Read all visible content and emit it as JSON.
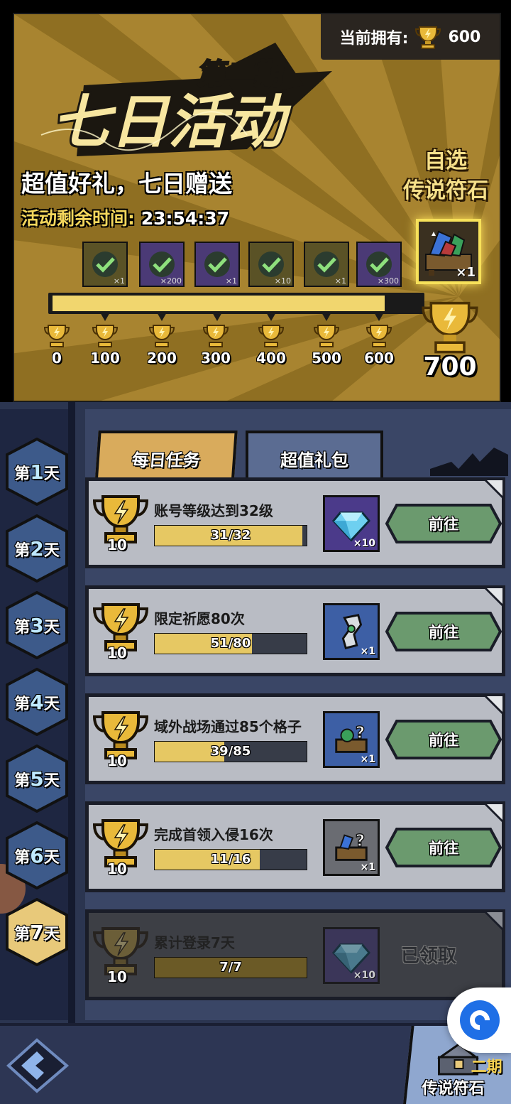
{
  "header": {
    "owned_label": "当前拥有:",
    "owned_value": "600",
    "phase": "第二期",
    "title": "七日活动",
    "subtitle": "超值好礼，七日赠送",
    "timer_label": "活动剩余时间:",
    "timer_value": "23:54:37",
    "pick_line1": "自选",
    "pick_line2": "传说符石"
  },
  "milestones": [
    {
      "points": "0",
      "qty": "×1",
      "claimed": true,
      "kind": "chest"
    },
    {
      "points": "100",
      "qty": "×200",
      "claimed": true,
      "kind": "gem"
    },
    {
      "points": "200",
      "qty": "×1",
      "claimed": true,
      "kind": "scroll"
    },
    {
      "points": "300",
      "qty": "×10",
      "claimed": true,
      "kind": "box"
    },
    {
      "points": "400",
      "qty": "×1",
      "claimed": true,
      "kind": "chest"
    },
    {
      "points": "500",
      "qty": "×300",
      "claimed": true,
      "kind": "gem"
    },
    {
      "points": "600",
      "qty": "",
      "claimed": true,
      "kind": "none"
    }
  ],
  "final_reward": {
    "points": "700",
    "qty": "×1"
  },
  "progress": {
    "current": 600,
    "max": 700
  },
  "days": [
    {
      "label_pre": "第",
      "num": "1",
      "label_post": "天"
    },
    {
      "label_pre": "第",
      "num": "2",
      "label_post": "天"
    },
    {
      "label_pre": "第",
      "num": "3",
      "label_post": "天"
    },
    {
      "label_pre": "第",
      "num": "4",
      "label_post": "天"
    },
    {
      "label_pre": "第",
      "num": "5",
      "label_post": "天"
    },
    {
      "label_pre": "第",
      "num": "6",
      "label_post": "天"
    },
    {
      "label_pre": "第",
      "num": "7",
      "label_post": "天"
    }
  ],
  "active_day": 7,
  "tabs": {
    "daily": "每日任务",
    "packs": "超值礼包"
  },
  "tasks": [
    {
      "name": "账号等级达到32级",
      "points": "10",
      "progress_text": "31/32",
      "progress": 0.97,
      "item_qty": "×10",
      "item": "diamond",
      "action": "前往",
      "done": false
    },
    {
      "name": "限定祈愿80次",
      "points": "10",
      "progress_text": "51/80",
      "progress": 0.64,
      "item_qty": "×1",
      "item": "scroll",
      "action": "前往",
      "done": false
    },
    {
      "name": "域外战场通过85个格子",
      "points": "10",
      "progress_text": "39/85",
      "progress": 0.46,
      "item_qty": "×1",
      "item": "mystery-chest",
      "action": "前往",
      "done": false
    },
    {
      "name": "完成首领入侵16次",
      "points": "10",
      "progress_text": "11/16",
      "progress": 0.69,
      "item_qty": "×1",
      "item": "mystery-chest",
      "action": "前往",
      "done": false
    },
    {
      "name": "累计登录7天",
      "points": "10",
      "progress_text": "7/7",
      "progress": 1.0,
      "item_qty": "×10",
      "item": "diamond",
      "action": "已领取",
      "done": true
    }
  ],
  "footer": {
    "legend_label": "传说符石",
    "legend_phase": "二期"
  },
  "colors": {
    "gold": "#f1d66e",
    "banner": "#b08a2e",
    "navy": "#2b3550",
    "green_btn": "#6b9a6e"
  }
}
